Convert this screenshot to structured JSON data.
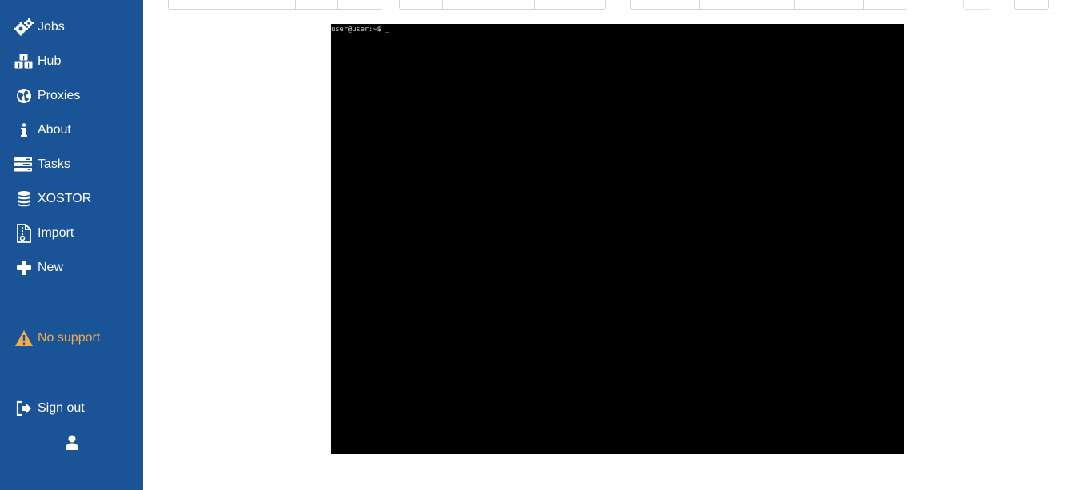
{
  "sidebar": {
    "items": [
      {
        "label": "Jobs",
        "icon": "gears-icon"
      },
      {
        "label": "Hub",
        "icon": "cubes-icon"
      },
      {
        "label": "Proxies",
        "icon": "globe-icon"
      },
      {
        "label": "About",
        "icon": "info-icon"
      },
      {
        "label": "Tasks",
        "icon": "tasks-icon"
      },
      {
        "label": "XOSTOR",
        "icon": "database-icon"
      },
      {
        "label": "Import",
        "icon": "file-import-icon"
      },
      {
        "label": "New",
        "icon": "plus-icon"
      }
    ],
    "support": {
      "label": "No support",
      "icon": "warning-icon",
      "color": "#f0ad4e"
    },
    "sign_out": {
      "label": "Sign out",
      "icon": "sign-out-icon"
    },
    "user_icon": "user-icon"
  },
  "console": {
    "prompt": "user@user:~$ _",
    "background": "#000000"
  },
  "colors": {
    "sidebar_bg": "#1b5496",
    "sidebar_text": "#ffffff",
    "warning": "#f0ad4e"
  }
}
